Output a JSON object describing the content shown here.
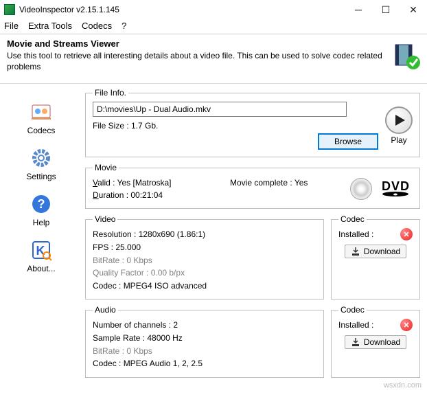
{
  "window": {
    "title": "VideoInspector v2.15.1.145"
  },
  "menu": {
    "file": "File",
    "extra": "Extra Tools",
    "codecs": "Codecs",
    "help": "?"
  },
  "header": {
    "title": "Movie and Streams Viewer",
    "desc": "Use this tool to retrieve all interesting details about a video file. This can be used to solve codec related problems"
  },
  "sidebar": {
    "codecs": "Codecs",
    "settings": "Settings",
    "help": "Help",
    "about": "About..."
  },
  "file": {
    "legend": "File Info.",
    "path": "D:\\movies\\Up - Dual Audio.mkv",
    "size_label": "File Size : 1.7 Gb.",
    "browse": "Browse",
    "play": "Play"
  },
  "movie": {
    "legend": "Movie",
    "valid": "Valid : Yes [Matroska]",
    "duration": "Duration : 00:21:04",
    "complete": "Movie complete : Yes"
  },
  "video": {
    "legend": "Video",
    "resolution": "Resolution : 1280x690 (1.86:1)",
    "fps": "FPS : 25.000",
    "bitrate": "BitRate : 0 Kbps",
    "qf": "Quality Factor : 0.00 b/px",
    "codec": "Codec : MPEG4 ISO advanced"
  },
  "audio": {
    "legend": "Audio",
    "channels": "Number of channels : 2",
    "sample": "Sample Rate : 48000 Hz",
    "bitrate": "BitRate : 0 Kbps",
    "codec": "Codec : MPEG Audio 1, 2, 2.5"
  },
  "codec": {
    "legend": "Codec",
    "installed": "Installed :",
    "download": "Download"
  },
  "watermark": "wsxdn.com"
}
